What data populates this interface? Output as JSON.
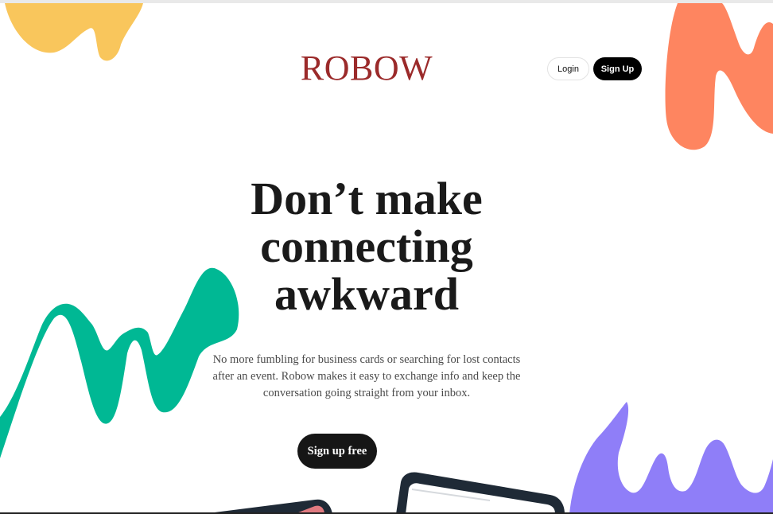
{
  "brand": {
    "name": "ROBOW",
    "color": "#9b2a2a"
  },
  "nav": {
    "login_label": "Login",
    "signup_label": "Sign Up"
  },
  "hero": {
    "headline": "Don’t make connecting awkward",
    "subtext": "No more fumbling for business cards or searching for lost contacts after an event. Robow makes it easy to exchange info and keep the conversation going straight from your inbox.",
    "subtext_color": "#4a4a4a",
    "cta_label": "Sign up free"
  },
  "decor": {
    "yellow": "#f9c65c",
    "orange": "#fe8560",
    "green": "#00b894",
    "purple": "#8f7ef8",
    "device_frame": "#1f2a36"
  }
}
